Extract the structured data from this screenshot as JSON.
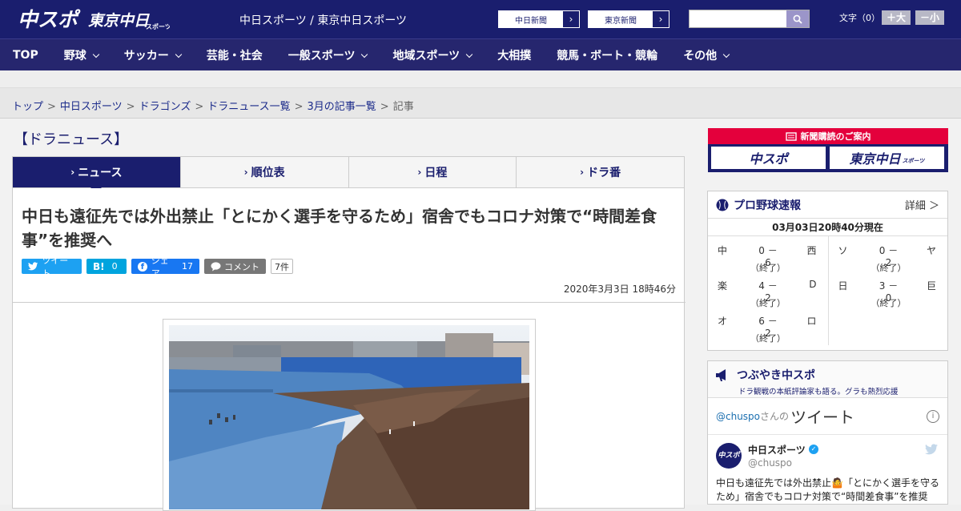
{
  "header": {
    "logo_main": "中スポ",
    "logo_sub": "東京中日",
    "logo_sub_small": "スポーツ",
    "pub_title": "中日スポーツ / 東京中日スポーツ",
    "link1": "中日新聞",
    "link2": "東京新聞",
    "search_placeholder": "",
    "fontsize_label": "文字（0）",
    "fontsize_plus": "＋大",
    "fontsize_minus": "－小"
  },
  "nav": [
    {
      "label": "TOP",
      "dropdown": false
    },
    {
      "label": "野球",
      "dropdown": true
    },
    {
      "label": "サッカー",
      "dropdown": true
    },
    {
      "label": "芸能・社会",
      "dropdown": false
    },
    {
      "label": "一般スポーツ",
      "dropdown": true
    },
    {
      "label": "地域スポーツ",
      "dropdown": true
    },
    {
      "label": "大相撲",
      "dropdown": false
    },
    {
      "label": "競馬・ボート・競輪",
      "dropdown": false
    },
    {
      "label": "その他",
      "dropdown": true
    }
  ],
  "breadcrumb": [
    "トップ",
    "中日スポーツ",
    "ドラゴンズ",
    "ドラニュース一覧",
    "3月の記事一覧",
    "記事"
  ],
  "section_title": "【ドラニュース】",
  "tabs": [
    "ニュース",
    "順位表",
    "日程",
    "ドラ番"
  ],
  "article": {
    "headline": "中日も遠征先では外出禁止「とにかく選手を守るため」宿舎でもコロナ対策で“時間差食事”を推奨へ",
    "share": {
      "tweet": "ツイート",
      "hatena_count": "0",
      "facebook": "シェア",
      "facebook_count": "17",
      "comment": "コメント",
      "comment_count": "7件"
    },
    "date": "2020年3月3日 18時46分"
  },
  "sidebar": {
    "subscribe": {
      "title": "新聞購読のご案内",
      "logo1": "中スポ",
      "logo2": "東京中日",
      "logo2_small": "スポーツ"
    },
    "scores": {
      "title": "プロ野球速報",
      "more": "詳細 ＞",
      "time": "03月03日20時40分現在",
      "left": [
        {
          "home": "中",
          "score": "0 － 6",
          "away": "西",
          "status": "（終了）"
        },
        {
          "home": "楽",
          "score": "4 － 2",
          "away": "D",
          "status": "（終了）"
        },
        {
          "home": "オ",
          "score": "6 － 2",
          "away": "ロ",
          "status": "（終了）"
        }
      ],
      "right": [
        {
          "home": "ソ",
          "score": "0 － 2",
          "away": "ヤ",
          "status": "（終了）"
        },
        {
          "home": "日",
          "score": "3 － 0",
          "away": "巨",
          "status": "（終了）"
        }
      ]
    },
    "tweets": {
      "title": "つぶやき中スポ",
      "subtitle": "ドラ観戦の本紙評論家も語る。グラも熱烈応援",
      "handle": "@chuspo",
      "handle_suffix": "さんの",
      "label": "ツイート",
      "info": "i",
      "item": {
        "avatar": "中スポ",
        "name": "中日スポーツ",
        "user": "@chuspo",
        "text": "中日も遠征先では外出禁止🤷「とにかく選手を守るため」宿舎でもコロナ対策で“時間差食事”を推奨"
      }
    }
  },
  "colors": {
    "brand": "#1a1e6e",
    "accent": "#e4003c",
    "twitter": "#1da1f2",
    "facebook": "#1877f2",
    "hatena": "#00a4de"
  }
}
